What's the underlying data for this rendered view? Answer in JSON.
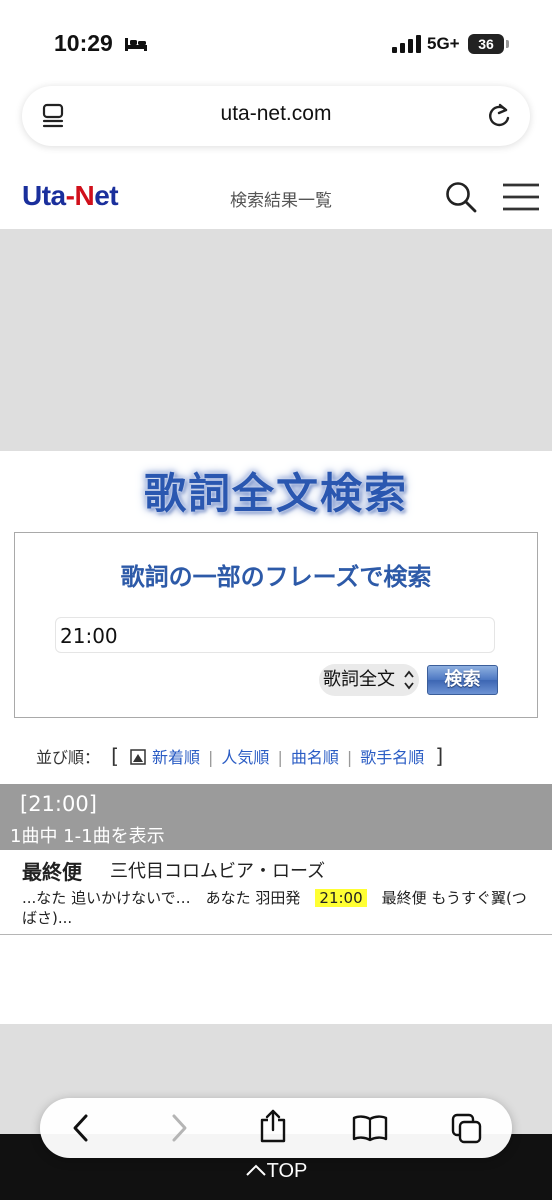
{
  "status_bar": {
    "time": "10:29",
    "network": "5G+",
    "battery": "36"
  },
  "browser": {
    "url": "uta-net.com"
  },
  "site_header": {
    "logo_uta": "Uta",
    "logo_dash": "-",
    "logo_n": "N",
    "logo_et": "et",
    "page_title": "検索結果一覧"
  },
  "banner": {
    "title": "歌詞全文検索"
  },
  "search_box": {
    "heading": "歌詞の一部のフレーズで検索",
    "query_value": "21:00",
    "mode_selected": "歌詞全文",
    "search_button": "検索"
  },
  "sort": {
    "label": "並び順：",
    "open_bracket": "[",
    "close_bracket": "]",
    "options": [
      "新着順",
      "人気順",
      "曲名順",
      "歌手名順"
    ]
  },
  "results": {
    "term": "[21:00]",
    "count_text": "1曲中 1-1曲を表示",
    "items": [
      {
        "title": "最終便",
        "artist": "三代目コロムビア・ローズ",
        "snippet_before": "...なた 追いかけないで…　あなた 羽田発　",
        "snippet_highlight": "21:00",
        "snippet_after": "　最終便 もうすぐ翼(つばさ)..."
      }
    ]
  },
  "footer": {
    "top_link": "TOP"
  },
  "colors": {
    "brand_blue": "#1a2f9c",
    "brand_red": "#d0101b",
    "heading_blue": "#2d5aa8",
    "link_blue": "#2a5cc4",
    "highlight": "#ffff33"
  }
}
